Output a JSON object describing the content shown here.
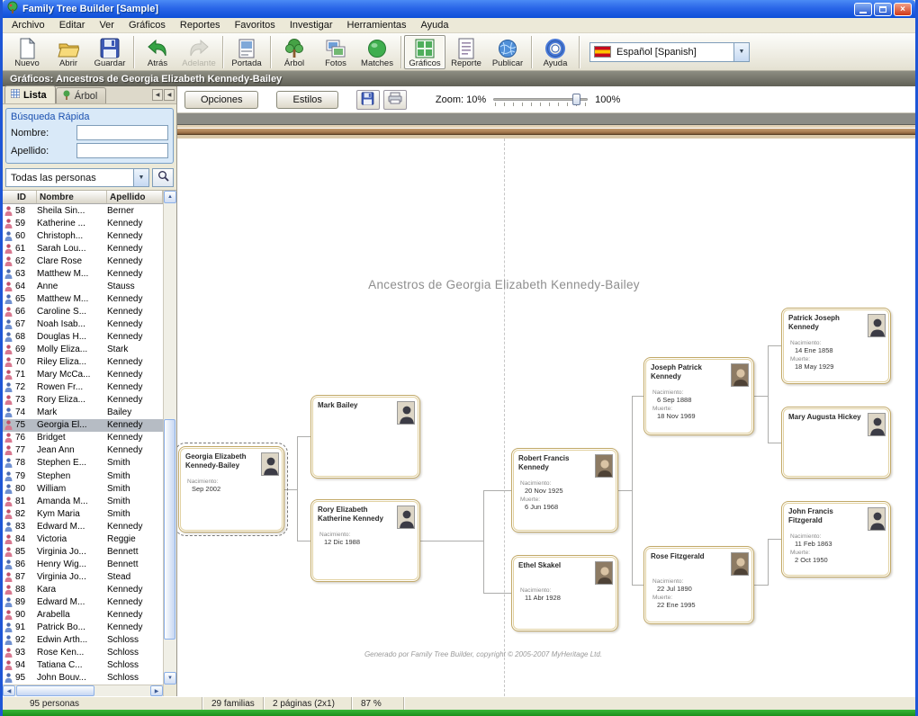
{
  "colors": {
    "titlebar_blue": "#1e56d6",
    "chart_header_olive": "#72726a",
    "selection_gray": "#b6bcc4",
    "gold_border": "#c2a968",
    "desktop_green": "#22a822"
  },
  "window": {
    "title": "Family Tree Builder [Sample]"
  },
  "menu_bar": {
    "items": [
      "Archivo",
      "Editar",
      "Ver",
      "Gráficos",
      "Reportes",
      "Favoritos",
      "Investigar",
      "Herramientas",
      "Ayuda"
    ]
  },
  "toolbar": {
    "buttons": [
      {
        "label": "Nuevo",
        "icon": "new-document-icon"
      },
      {
        "label": "Abrir",
        "icon": "open-folder-icon"
      },
      {
        "label": "Guardar",
        "icon": "save-icon"
      },
      {
        "label": "Atrás",
        "icon": "back-icon",
        "group_start": true
      },
      {
        "label": "Adelante",
        "icon": "forward-icon",
        "disabled": true
      },
      {
        "label": "Portada",
        "icon": "cover-page-icon",
        "group_start": true
      },
      {
        "label": "Árbol",
        "icon": "tree-icon",
        "group_start": true
      },
      {
        "label": "Fotos",
        "icon": "photos-icon"
      },
      {
        "label": "Matches",
        "icon": "matches-icon"
      },
      {
        "label": "Gráficos",
        "icon": "charts-icon",
        "selected": true,
        "group_start": true
      },
      {
        "label": "Reporte",
        "icon": "report-icon"
      },
      {
        "label": "Publicar",
        "icon": "publish-globe-icon"
      },
      {
        "label": "Ayuda",
        "icon": "help-icon",
        "group_start": true
      }
    ],
    "language_value": "Español [Spanish]"
  },
  "chart_header": {
    "title": "Gráficos: Ancestros de Georgia Elizabeth Kennedy-Bailey"
  },
  "sidebar": {
    "tabs": [
      "Lista",
      "Árbol"
    ],
    "quick_search": {
      "title": "Búsqueda Rápida",
      "name_label": "Nombre:",
      "surname_label": "Apellido:",
      "name_value": "",
      "surname_value": ""
    },
    "filter_value": "Todas las personas",
    "table": {
      "columns": [
        "ID",
        "Nombre",
        "Apellido"
      ],
      "selected_id": "75",
      "rows": [
        {
          "id": "58",
          "name": "Sheila Sin...",
          "surname": "Berner",
          "gender": "F"
        },
        {
          "id": "59",
          "name": "Katherine ...",
          "surname": "Kennedy",
          "gender": "F"
        },
        {
          "id": "60",
          "name": "Christoph...",
          "surname": "Kennedy",
          "gender": "M"
        },
        {
          "id": "61",
          "name": "Sarah Lou...",
          "surname": "Kennedy",
          "gender": "F"
        },
        {
          "id": "62",
          "name": "Clare Rose",
          "surname": "Kennedy",
          "gender": "F"
        },
        {
          "id": "63",
          "name": "Matthew M...",
          "surname": "Kennedy",
          "gender": "M"
        },
        {
          "id": "64",
          "name": "Anne",
          "surname": "Stauss",
          "gender": "F"
        },
        {
          "id": "65",
          "name": "Matthew M...",
          "surname": "Kennedy",
          "gender": "M"
        },
        {
          "id": "66",
          "name": "Caroline S...",
          "surname": "Kennedy",
          "gender": "F"
        },
        {
          "id": "67",
          "name": "Noah Isab...",
          "surname": "Kennedy",
          "gender": "M"
        },
        {
          "id": "68",
          "name": "Douglas H...",
          "surname": "Kennedy",
          "gender": "M"
        },
        {
          "id": "69",
          "name": "Molly Eliza...",
          "surname": "Stark",
          "gender": "F"
        },
        {
          "id": "70",
          "name": "Riley Eliza...",
          "surname": "Kennedy",
          "gender": "F"
        },
        {
          "id": "71",
          "name": "Mary McCa...",
          "surname": "Kennedy",
          "gender": "F"
        },
        {
          "id": "72",
          "name": "Rowen Fr...",
          "surname": "Kennedy",
          "gender": "M"
        },
        {
          "id": "73",
          "name": "Rory Eliza...",
          "surname": "Kennedy",
          "gender": "F"
        },
        {
          "id": "74",
          "name": "Mark",
          "surname": "Bailey",
          "gender": "M"
        },
        {
          "id": "75",
          "name": "Georgia El...",
          "surname": "Kennedy",
          "gender": "F"
        },
        {
          "id": "76",
          "name": "Bridget",
          "surname": "Kennedy",
          "gender": "F"
        },
        {
          "id": "77",
          "name": "Jean Ann",
          "surname": "Kennedy",
          "gender": "F"
        },
        {
          "id": "78",
          "name": "Stephen E...",
          "surname": "Smith",
          "gender": "M"
        },
        {
          "id": "79",
          "name": "Stephen",
          "surname": "Smith",
          "gender": "M"
        },
        {
          "id": "80",
          "name": "William",
          "surname": "Smith",
          "gender": "M"
        },
        {
          "id": "81",
          "name": "Amanda M...",
          "surname": "Smith",
          "gender": "F"
        },
        {
          "id": "82",
          "name": "Kym Maria",
          "surname": "Smith",
          "gender": "F"
        },
        {
          "id": "83",
          "name": "Edward M...",
          "surname": "Kennedy",
          "gender": "M"
        },
        {
          "id": "84",
          "name": "Victoria",
          "surname": "Reggie",
          "gender": "F"
        },
        {
          "id": "85",
          "name": "Virginia Jo...",
          "surname": "Bennett",
          "gender": "F"
        },
        {
          "id": "86",
          "name": "Henry Wig...",
          "surname": "Bennett",
          "gender": "M"
        },
        {
          "id": "87",
          "name": "Virginia Jo...",
          "surname": "Stead",
          "gender": "F"
        },
        {
          "id": "88",
          "name": "Kara",
          "surname": "Kennedy",
          "gender": "F"
        },
        {
          "id": "89",
          "name": "Edward M...",
          "surname": "Kennedy",
          "gender": "M"
        },
        {
          "id": "90",
          "name": "Arabella",
          "surname": "Kennedy",
          "gender": "F"
        },
        {
          "id": "91",
          "name": "Patrick Bo...",
          "surname": "Kennedy",
          "gender": "M"
        },
        {
          "id": "92",
          "name": "Edwin Arth...",
          "surname": "Schloss",
          "gender": "M"
        },
        {
          "id": "93",
          "name": "Rose Ken...",
          "surname": "Schloss",
          "gender": "F"
        },
        {
          "id": "94",
          "name": "Tatiana C...",
          "surname": "Schloss",
          "gender": "F"
        },
        {
          "id": "95",
          "name": "John Bouv...",
          "surname": "Schloss",
          "gender": "M"
        }
      ]
    }
  },
  "chart_toolbar": {
    "options": "Opciones",
    "styles": "Estilos",
    "zoom_label": "Zoom: 10%",
    "zoom_right": "100%"
  },
  "chart": {
    "title": "Ancestros de Georgia Elizabeth Kennedy-Bailey",
    "footer": "Generado por Family Tree Builder, copyright © 2005-2007 MyHeritage Ltd.",
    "birth_label": "Nacimiento:",
    "death_label": "Muerte:",
    "nodes": [
      {
        "key": "georgia",
        "name": "Georgia Elizabeth Kennedy-Bailey",
        "birth": "Sep 2002",
        "death": "",
        "photo": "silhouette",
        "selected": true
      },
      {
        "key": "mark",
        "name": "Mark Bailey",
        "birth": "",
        "death": "",
        "photo": "silhouette",
        "selected": false
      },
      {
        "key": "rory",
        "name": "Rory Elizabeth Katherine Kennedy",
        "birth": "12 Dic 1988",
        "death": "",
        "photo": "silhouette",
        "selected": false
      },
      {
        "key": "robert",
        "name": "Robert Francis Kennedy",
        "birth": "20 Nov 1925",
        "death": "6 Jun 1968",
        "photo": "photo",
        "selected": false
      },
      {
        "key": "ethel",
        "name": "Ethel Skakel",
        "birth": "11 Abr 1928",
        "death": "",
        "photo": "photo",
        "selected": false
      },
      {
        "key": "joseph",
        "name": "Joseph Patrick Kennedy",
        "birth": "6 Sep 1888",
        "death": "18 Nov 1969",
        "photo": "photo",
        "selected": false
      },
      {
        "key": "rose",
        "name": "Rose Fitzgerald",
        "birth": "22 Jul 1890",
        "death": "22 Ene 1995",
        "photo": "photo",
        "selected": false
      },
      {
        "key": "patrick",
        "name": "Patrick Joseph Kennedy",
        "birth": "14 Ene 1858",
        "death": "18 May 1929",
        "photo": "silhouette",
        "selected": false
      },
      {
        "key": "mary",
        "name": "Mary Augusta Hickey",
        "birth": "",
        "death": "",
        "photo": "silhouette",
        "selected": false
      },
      {
        "key": "john",
        "name": "John Francis Fitzgerald",
        "birth": "11 Feb 1863",
        "death": "2 Oct 1950",
        "photo": "silhouette",
        "selected": false
      }
    ]
  },
  "status_bar": {
    "persons": "95 personas",
    "families": "29 familias",
    "pages": "2 páginas (2x1)",
    "zoom": "87 %"
  }
}
